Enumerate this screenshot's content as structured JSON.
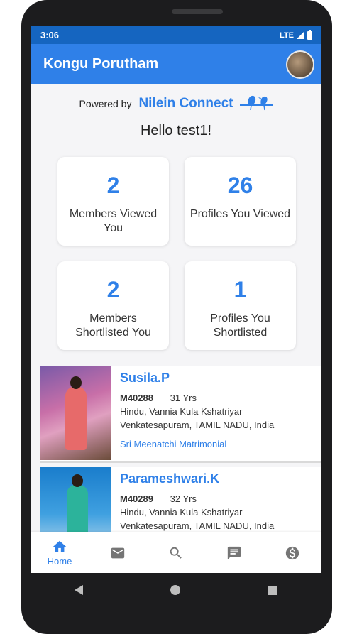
{
  "status": {
    "time": "3:06",
    "network": "LTE"
  },
  "appbar": {
    "title": "Kongu Porutham"
  },
  "powered": {
    "label": "Powered by",
    "brand": "Nilein Connect"
  },
  "greeting": "Hello test1!",
  "stats": [
    {
      "value": "2",
      "label": "Members Viewed You"
    },
    {
      "value": "26",
      "label": "Profiles You Viewed"
    },
    {
      "value": "2",
      "label": "Members Shortlisted You"
    },
    {
      "value": "1",
      "label": "Profiles You Shortlisted"
    }
  ],
  "profiles": [
    {
      "name": "Susila.P",
      "id": "M40288",
      "age": "31 Yrs",
      "community": "Hindu, Vannia Kula Kshatriyar",
      "location": "Venkatesapuram, TAMIL NADU, India",
      "agency": "Sri Meenatchi Matrimonial"
    },
    {
      "name": "Parameshwari.K",
      "id": "M40289",
      "age": "32 Yrs",
      "community": "Hindu, Vannia Kula Kshatriyar",
      "location": "Venkatesapuram, TAMIL NADU, India"
    }
  ],
  "bottom_nav": {
    "home_label": "Home"
  },
  "colors": {
    "primary": "#2f80e8",
    "status_bar": "#1565c0"
  }
}
